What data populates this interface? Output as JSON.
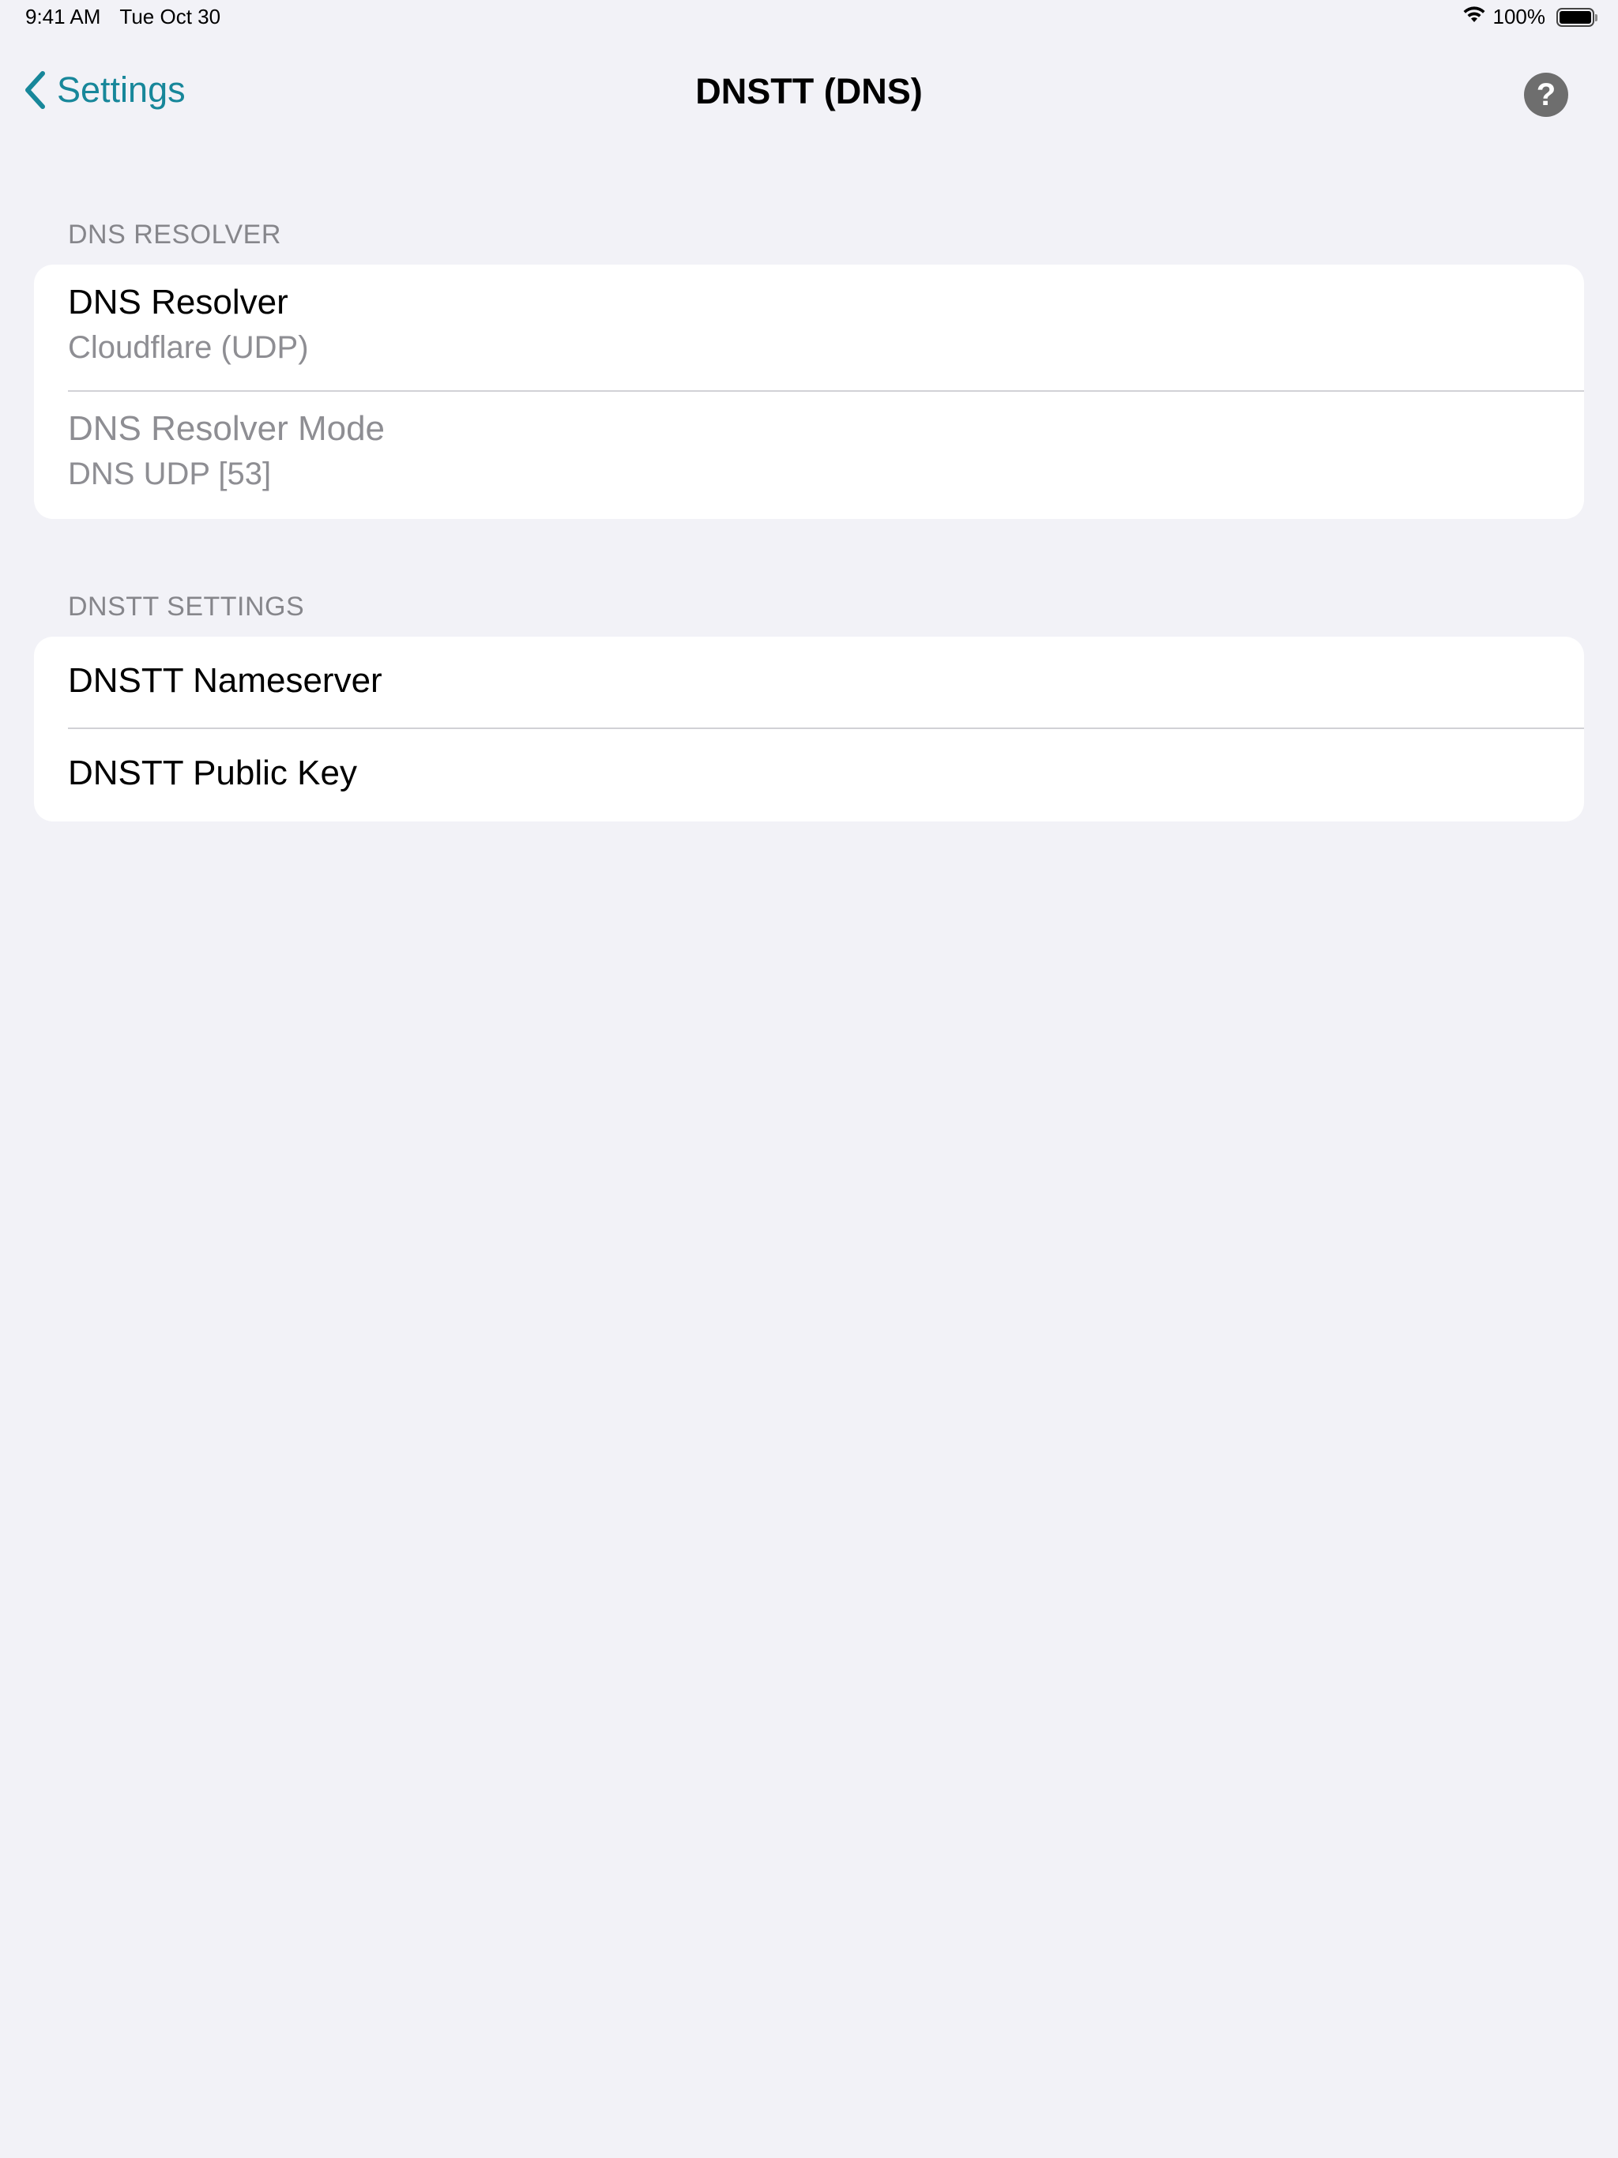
{
  "status_bar": {
    "time": "9:41 AM",
    "date": "Tue Oct 30",
    "battery_percent": "100%",
    "battery_level": 1.0
  },
  "nav": {
    "back_label": "Settings",
    "title": "DNSTT (DNS)",
    "help_symbol": "?"
  },
  "sections": {
    "resolver": {
      "header": "DNS RESOLVER",
      "rows": [
        {
          "title": "DNS Resolver",
          "subtitle": "Cloudflare (UDP)",
          "enabled": true
        },
        {
          "title": "DNS Resolver Mode",
          "subtitle": "DNS UDP [53]",
          "enabled": false
        }
      ]
    },
    "dnstt": {
      "header": "DNSTT SETTINGS",
      "rows": [
        {
          "title": "DNSTT Nameserver"
        },
        {
          "title": "DNSTT Public Key"
        }
      ]
    }
  },
  "colors": {
    "accent": "#17879a",
    "background": "#f2f2f7",
    "secondary_text": "#8e8e93"
  },
  "icons": {
    "back": "chevron-left-icon",
    "help": "question-circle-icon",
    "wifi": "wifi-icon",
    "battery": "battery-icon"
  }
}
